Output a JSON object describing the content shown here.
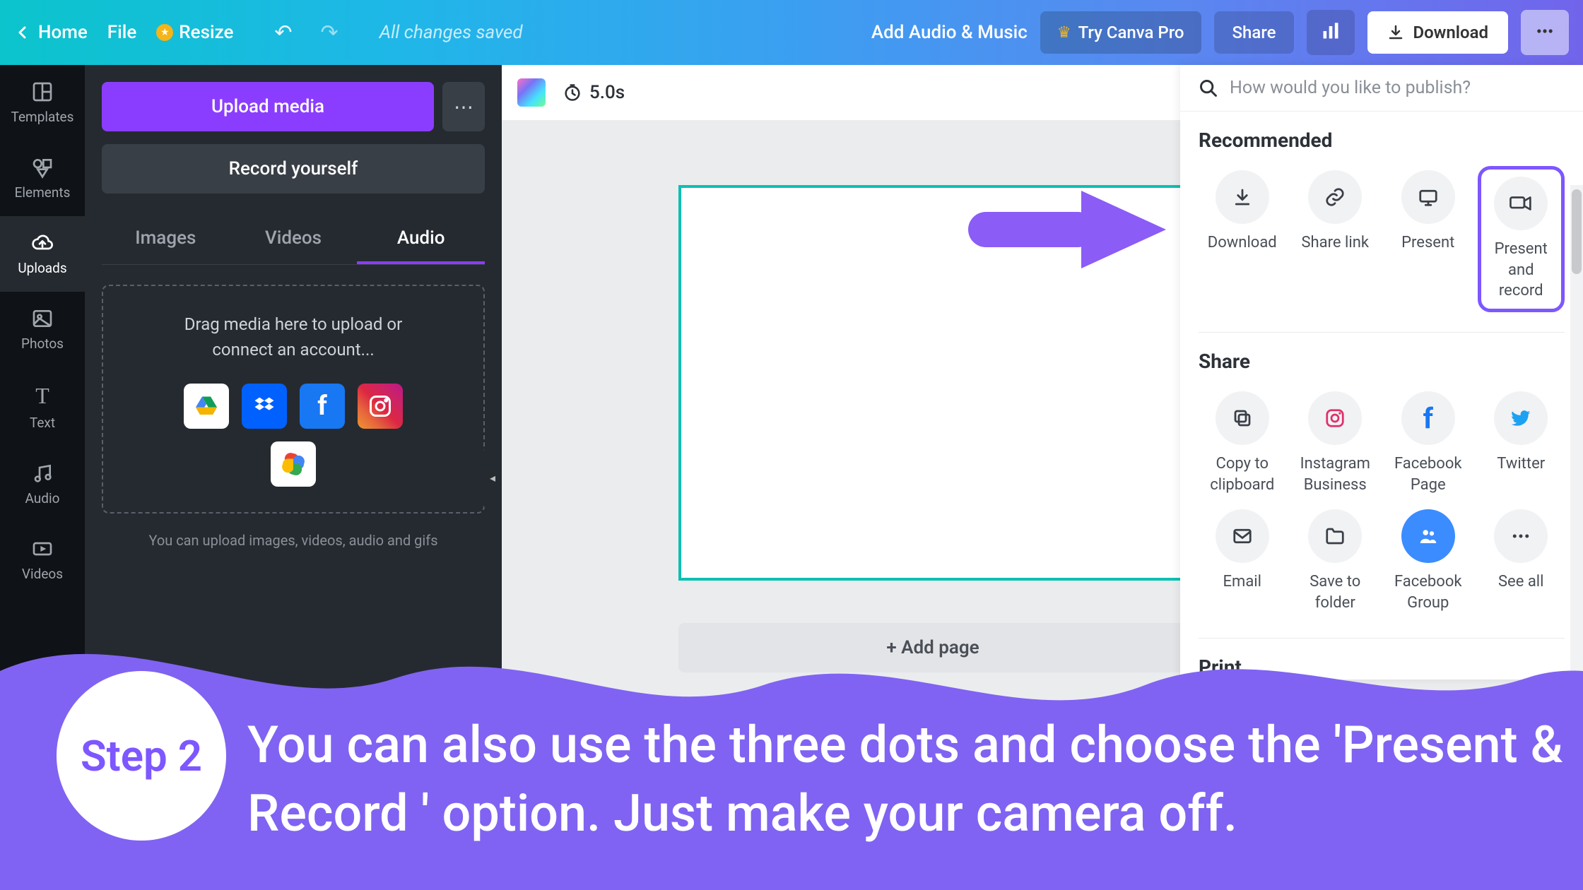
{
  "topbar": {
    "home": "Home",
    "file": "File",
    "resize": "Resize",
    "saved": "All changes saved",
    "audio_music": "Add Audio & Music",
    "try_pro": "Try Canva Pro",
    "share": "Share",
    "download": "Download"
  },
  "leftrail": {
    "templates": "Templates",
    "elements": "Elements",
    "uploads": "Uploads",
    "photos": "Photos",
    "text": "Text",
    "audio": "Audio",
    "videos": "Videos"
  },
  "sidepanel": {
    "upload_media": "Upload media",
    "record_yourself": "Record yourself",
    "tabs": {
      "images": "Images",
      "videos": "Videos",
      "audio": "Audio"
    },
    "dropzone_line1": "Drag media here to upload or",
    "dropzone_line2": "connect an account...",
    "note": "You can upload images, videos, audio and gifs"
  },
  "canvas": {
    "duration": "5.0s",
    "add_page": "+ Add page"
  },
  "publish": {
    "placeholder": "How would you like to publish?",
    "recommended_heading": "Recommended",
    "recommended": {
      "download": "Download",
      "share_link": "Share link",
      "present": "Present",
      "present_record": "Present\nand record"
    },
    "share_heading": "Share",
    "share": {
      "copy_clipboard": "Copy to\nclipboard",
      "instagram_business": "Instagram\nBusiness",
      "facebook_page": "Facebook\nPage",
      "twitter": "Twitter",
      "email": "Email",
      "save_folder": "Save to\nfolder",
      "facebook_group": "Facebook\nGroup",
      "see_all": "See all"
    },
    "print_heading": "Print"
  },
  "banner": {
    "step": "Step 2",
    "text": "You can also use the three dots and choose the 'Present & Record ' option. Just make your camera off."
  }
}
